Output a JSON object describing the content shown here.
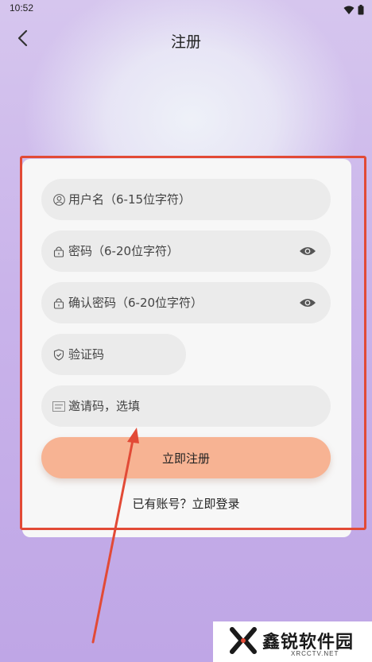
{
  "status_bar": {
    "time": "10:52",
    "icons": [
      "wifi-icon",
      "battery-icon"
    ]
  },
  "header": {
    "back_icon": "chevron-left-icon",
    "title": "注册"
  },
  "form": {
    "username": {
      "icon": "user-icon",
      "placeholder": "用户名（6-15位字符）",
      "value": ""
    },
    "password": {
      "icon": "lock-icon",
      "placeholder": "密码（6-20位字符）",
      "value": "",
      "toggle_icon": "eye-icon"
    },
    "confirm_password": {
      "icon": "lock-icon",
      "placeholder": "确认密码（6-20位字符）",
      "value": "",
      "toggle_icon": "eye-icon"
    },
    "verification_code": {
      "icon": "shield-check-icon",
      "placeholder": "验证码",
      "value": ""
    },
    "invite_code": {
      "icon": "abc-icon",
      "placeholder": "邀请码，选填",
      "value": ""
    },
    "register_label": "立即注册",
    "login_prompt": "已有账号？立即登录"
  },
  "colors": {
    "register_button": "#f7b393",
    "annotation": "#e24a36",
    "field_background": "#ebebeb",
    "card_background": "#f7f7f7"
  },
  "watermark": {
    "text": "鑫锐软件园",
    "sub": "XRCCTV.NET"
  }
}
